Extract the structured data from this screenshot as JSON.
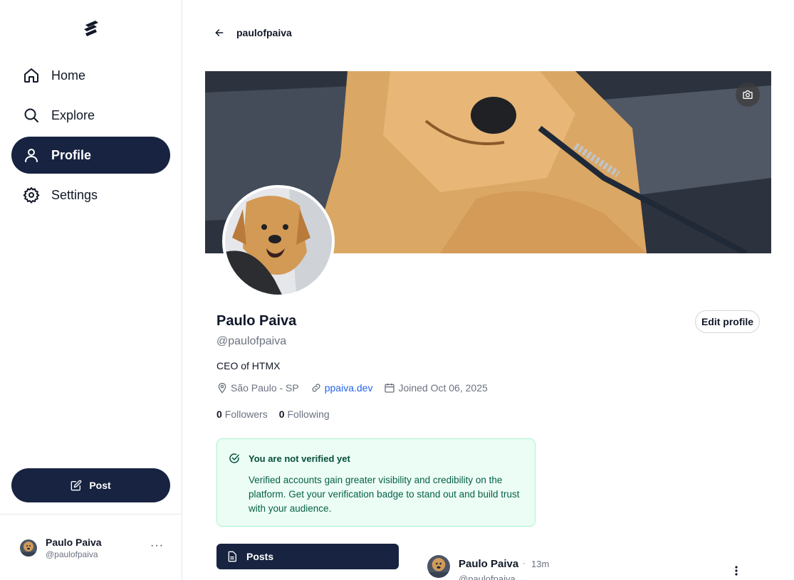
{
  "sidebar": {
    "logo": "stacked-s-logo",
    "nav": [
      {
        "label": "Home",
        "icon": "home-icon",
        "active": false
      },
      {
        "label": "Explore",
        "icon": "search-icon",
        "active": true
      },
      {
        "label": "Profile",
        "icon": "user-icon",
        "active": true
      },
      {
        "label": "Settings",
        "icon": "gear-icon",
        "active": false
      }
    ],
    "post_button": "Post",
    "account": {
      "name": "Paulo Paiva",
      "handle": "@paulofpaiva",
      "more": "···"
    }
  },
  "header": {
    "title": "paulofpaiva"
  },
  "profile": {
    "name": "Paulo Paiva",
    "handle": "@paulofpaiva",
    "bio": "CEO of HTMX",
    "location": "São Paulo - SP",
    "website": "ppaiva.dev",
    "joined": "Joined Oct 06, 2025",
    "followers_count": "0",
    "followers_label": "Followers",
    "following_count": "0",
    "following_label": "Following",
    "edit_button": "Edit profile"
  },
  "verification": {
    "title": "You are not verified yet",
    "body": "Verified accounts gain greater visibility and credibility on the platform. Get your verification badge to stand out and build trust with your audience."
  },
  "tabs": {
    "posts": "Posts"
  },
  "post_preview": {
    "name": "Paulo Paiva",
    "separator": "·",
    "time": "13m",
    "handle": "@paulofpaiva"
  },
  "colors": {
    "primary": "#172340",
    "verify_bg": "#ecfdf5",
    "link": "#2563eb"
  }
}
